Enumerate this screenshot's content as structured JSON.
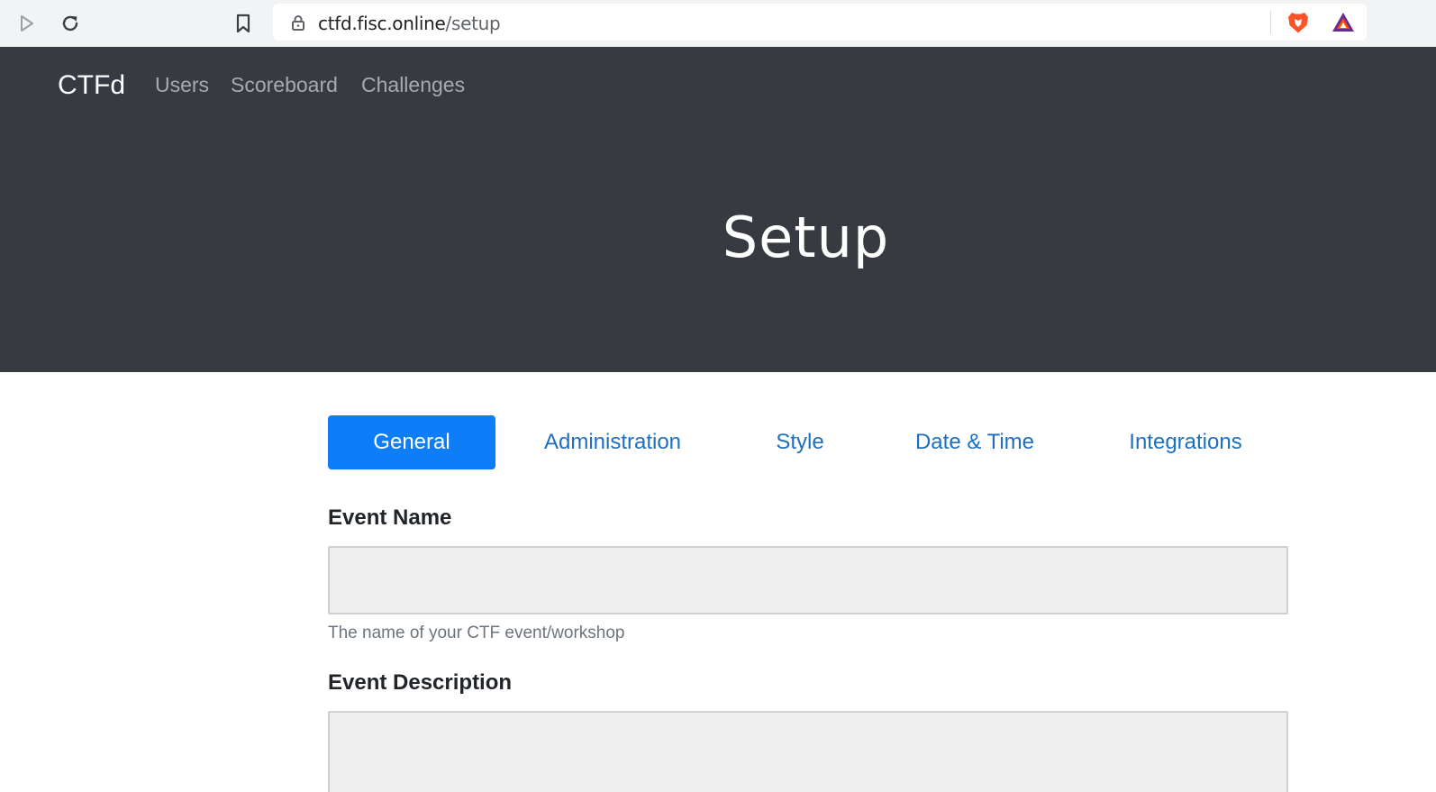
{
  "browser": {
    "url_host": "ctfd.fisc.online",
    "url_path": "/setup",
    "icons": [
      "play-icon",
      "reload-icon",
      "bookmark-icon",
      "lock-icon",
      "brave-shield-icon",
      "bat-rewards-icon"
    ]
  },
  "navbar": {
    "brand": "CTFd",
    "links": [
      "Users",
      "Scoreboard",
      "Challenges"
    ]
  },
  "hero": {
    "title": "Setup"
  },
  "tabs": [
    {
      "label": "General",
      "active": true
    },
    {
      "label": "Administration",
      "active": false
    },
    {
      "label": "Style",
      "active": false
    },
    {
      "label": "Date & Time",
      "active": false
    },
    {
      "label": "Integrations",
      "active": false
    }
  ],
  "form": {
    "event_name": {
      "label": "Event Name",
      "value": "",
      "help": "The name of your CTF event/workshop"
    },
    "event_description": {
      "label": "Event Description",
      "value": ""
    }
  },
  "colors": {
    "hero_bg": "#373a40",
    "accent": "#0d7ef8",
    "tab_link": "#1d6fbf",
    "input_bg": "#efefef"
  }
}
